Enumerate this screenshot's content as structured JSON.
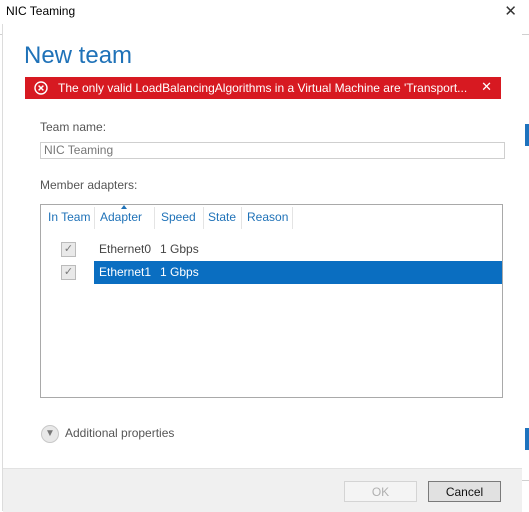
{
  "window": {
    "title": "NIC Teaming",
    "close_glyph": "✕"
  },
  "dialog": {
    "heading": "New team",
    "error": {
      "message": "The only valid LoadBalancingAlgorithms in a Virtual Machine are 'Transport...",
      "icon": "error-circle-icon",
      "dismiss_glyph": "✕",
      "color": "#d71921"
    },
    "team_name": {
      "label": "Team name:",
      "value": "NIC Teaming"
    },
    "member_adapters": {
      "label": "Member adapters:",
      "columns": [
        "In Team",
        "Adapter",
        "Speed",
        "State",
        "Reason"
      ],
      "sorted_column": "Adapter",
      "rows": [
        {
          "in_team": true,
          "adapter": "Ethernet0",
          "speed": "1 Gbps",
          "state": "",
          "reason": "",
          "selected": false
        },
        {
          "in_team": true,
          "adapter": "Ethernet1",
          "speed": "1 Gbps",
          "state": "",
          "reason": "",
          "selected": true
        }
      ]
    },
    "additional_properties": {
      "label": "Additional properties",
      "icon": "chevron-down-circle-icon"
    },
    "buttons": {
      "ok": "OK",
      "cancel": "Cancel"
    }
  },
  "colors": {
    "accent": "#1f72b8",
    "selection": "#0a6ec1"
  }
}
